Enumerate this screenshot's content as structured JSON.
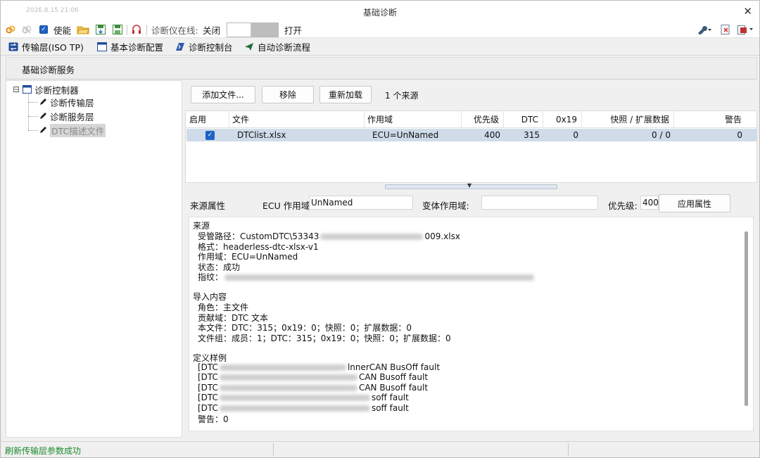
{
  "window": {
    "date_watermark": "2026.8.15 21:06",
    "title": "基础诊断",
    "close_glyph": "✕"
  },
  "toolbar": {
    "enable_label": "使能",
    "online_label": "诊断仪在线:",
    "off_label": "关闭",
    "on_label": "打开",
    "icons": [
      "link-icon",
      "unlink-icon",
      "folder-open-icon",
      "save-down-icon",
      "save-icon",
      "headset-icon",
      "wrench-icon",
      "exit-icon",
      "export-icon"
    ]
  },
  "nav": {
    "tabs": [
      {
        "label": "传输层(ISO TP)",
        "icon": "transfer-icon"
      },
      {
        "label": "基本诊断配置",
        "icon": "window-icon"
      },
      {
        "label": "诊断控制台",
        "icon": "console-icon"
      },
      {
        "label": "自动诊断流程",
        "icon": "send-icon"
      }
    ]
  },
  "service_header": "基础诊断服务",
  "tree": {
    "root": "诊断控制器",
    "children": [
      "诊断传输层",
      "诊断服务层",
      "DTC描述文件"
    ],
    "toggle": "⊟"
  },
  "actions": {
    "add_file": "添加文件...",
    "remove": "移除",
    "reload": "重新加载",
    "source_count": "1 个来源"
  },
  "table": {
    "columns": [
      "启用",
      "文件",
      "作用域",
      "优先级",
      "DTC",
      "0x19",
      "快照 / 扩展数据",
      "警告"
    ],
    "rows": [
      {
        "enabled": true,
        "file": "DTClist.xlsx",
        "scope": "ECU=UnNamed",
        "priority": "400",
        "dtc": "315",
        "x19": "0",
        "snapshot": "0 / 0",
        "warning": "0"
      }
    ]
  },
  "props": {
    "source_attr": "来源属性",
    "ecu_scope_label": "ECU 作用域:",
    "ecu_scope_value": "UnNamed",
    "variant_scope_label": "变体作用域:",
    "variant_scope_value": "",
    "priority_label": "优先级:",
    "priority_value": "400",
    "apply_button": "应用属性"
  },
  "detail": {
    "source_title": "来源",
    "path_prefix": "受管路径：CustomDTC\\53343",
    "path_suffix": "009.xlsx",
    "format": "格式：headerless-dtc-xlsx-v1",
    "scope": "作用域：ECU=UnNamed",
    "state": "状态：成功",
    "fingerprint": "指纹：",
    "import_title": "导入内容",
    "role": "角色：主文件",
    "contrib": "贡献域：DTC 文本",
    "this_file": "本文件：DTC：315；0x19：0；快照：0；扩展数据：0",
    "group": "文件组：成员：1；DTC：315；0x19：0；快照：0；扩展数据：0",
    "example_title": "定义样例",
    "examples": [
      {
        "prefix": "[DTC",
        "suffix": "lnnerCAN BusOff fault"
      },
      {
        "prefix": "[DTC",
        "suffix": "CAN Busoff fault"
      },
      {
        "prefix": "[DTC",
        "suffix": "CAN Busoff fault"
      },
      {
        "prefix": "[DTC",
        "suffix": "soff fault"
      },
      {
        "prefix": "[DTC",
        "suffix": "soff fault"
      }
    ],
    "warnings": "警告：0"
  },
  "status": {
    "message": "刷新传输层参数成功"
  },
  "colors": {
    "accent": "#1e63c4",
    "selected_row": "#cfdbe8",
    "status_ok": "#1b8a2a"
  }
}
